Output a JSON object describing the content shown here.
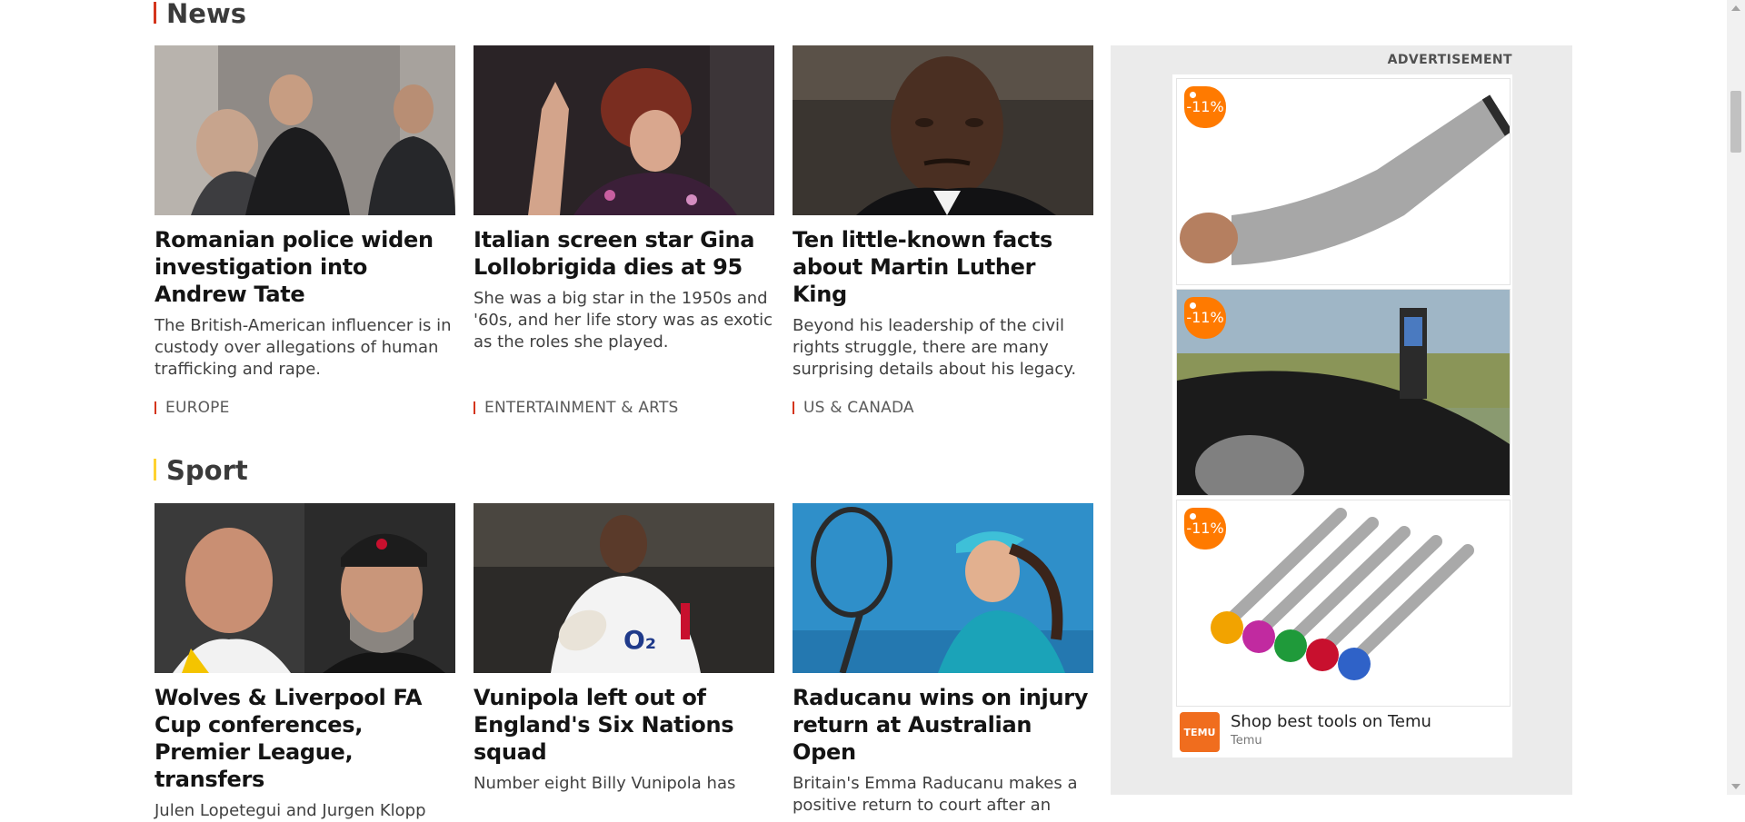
{
  "news": {
    "title": "News",
    "accent": "#d4351c",
    "cards": [
      {
        "headline": "Romanian police widen investigation into Andrew Tate",
        "summary": "The British-American influencer is in custody over allegations of human trafficking and rape.",
        "tag": "EUROPE"
      },
      {
        "headline": "Italian screen star Gina Lollobrigida dies at 95",
        "summary": "She was a big star in the 1950s and '60s, and her life story was as exotic as the roles she played.",
        "tag": "ENTERTAINMENT & ARTS"
      },
      {
        "headline": "Ten little-known facts about Martin Luther King",
        "summary": "Beyond his leadership of the civil rights struggle, there are many surprising details about his legacy.",
        "tag": "US & CANADA"
      }
    ]
  },
  "sport": {
    "title": "Sport",
    "accent": "#ffd230",
    "cards": [
      {
        "headline": "Wolves & Liverpool FA Cup conferences, Premier League, transfers",
        "summary": "Julen Lopetegui and Jurgen Klopp"
      },
      {
        "headline": "Vunipola left out of England's Six Nations squad",
        "summary": "Number eight Billy Vunipola has"
      },
      {
        "headline": "Raducanu wins on injury return at Australian Open",
        "summary": "Britain's Emma Raducanu makes a positive return to court after an"
      }
    ]
  },
  "advertisement": {
    "label": "ADVERTISEMENT",
    "adchoices_icon": "adchoices-icon",
    "close_icon": "close-icon",
    "tiles": [
      {
        "discount": "-11%",
        "product": "cut-resistant arm sleeve"
      },
      {
        "discount": "-11%",
        "product": "digital tyre tread depth gauge"
      },
      {
        "discount": "-11%",
        "product": "magnetic screwdriver bit set"
      }
    ],
    "cta": "Shop best tools on Temu",
    "advertiser": "Temu",
    "logo_text": "TEMU",
    "brand_color": "#f06d1e"
  }
}
